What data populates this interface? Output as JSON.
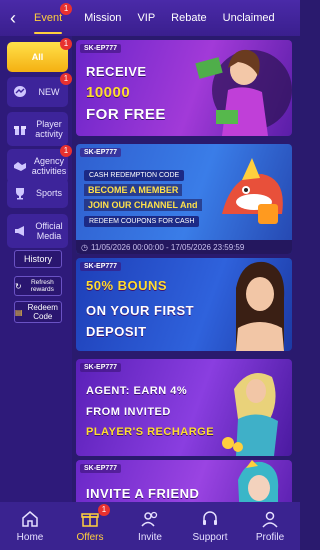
{
  "header": {
    "back_icon": "chevron-left-icon",
    "tabs": [
      {
        "label": "Event",
        "badge": "1",
        "active": true
      },
      {
        "label": "Mission"
      },
      {
        "label": "VIP"
      },
      {
        "label": "Rebate"
      },
      {
        "label": "Unclaimed"
      }
    ]
  },
  "sidebar": {
    "items": [
      {
        "label": "All",
        "badge": "1",
        "icon": "grid-icon",
        "active": true
      },
      {
        "label": "NEW",
        "badge": "1",
        "icon": "messenger-icon"
      },
      {
        "label": "Player activity",
        "icon": "gift-icon"
      },
      {
        "label": "Agency activities",
        "badge": "1",
        "icon": "handshake-icon"
      },
      {
        "label": "Sports",
        "icon": "trophy-icon"
      },
      {
        "label": "Official Media",
        "icon": "megaphone-icon"
      }
    ],
    "history_label": "History",
    "refresh_label": "Refresh rewards",
    "redeem_label": "Redeem Code"
  },
  "banners": [
    {
      "code": "SK-EP777",
      "lines": [
        "RECEIVE",
        "10000",
        "FOR FREE"
      ],
      "bg": "#8a2fd6"
    },
    {
      "code": "SK-EP777",
      "title_pill": "CASH REDEMPTION CODE",
      "lines": [
        "BECOME A MEMBER",
        "JOIN OUR CHANNEL And"
      ],
      "pill2": "REDEEM COUPONS FOR CASH",
      "date": "11/05/2026 00:00:00 - 17/05/2026 23:59:59",
      "bg": "#3a6fe0"
    },
    {
      "code": "SK-EP777",
      "lines": [
        "50% BOUNS",
        "ON YOUR FIRST",
        "DEPOSIT"
      ],
      "bg": "#2a55d8"
    },
    {
      "code": "SK-EP777",
      "lines": [
        "AGENT: EARN 4%",
        "FROM INVITED",
        "PLAYER'S RECHARGE"
      ],
      "bg": "#7a2fd0"
    },
    {
      "code": "SK-EP777",
      "lines": [
        "INVITE A FRIEND"
      ],
      "bg": "#8a3ae0"
    }
  ],
  "bottom_nav": [
    {
      "label": "Home",
      "icon": "home-icon"
    },
    {
      "label": "Offers",
      "icon": "gift-box-icon",
      "badge": "1",
      "active": true
    },
    {
      "label": "Invite",
      "icon": "users-icon"
    },
    {
      "label": "Support",
      "icon": "headset-icon"
    },
    {
      "label": "Profile",
      "icon": "user-icon"
    }
  ],
  "colors": {
    "accent": "#ffcf3d",
    "badge": "#e8312f",
    "background": "#2a1a6e"
  }
}
